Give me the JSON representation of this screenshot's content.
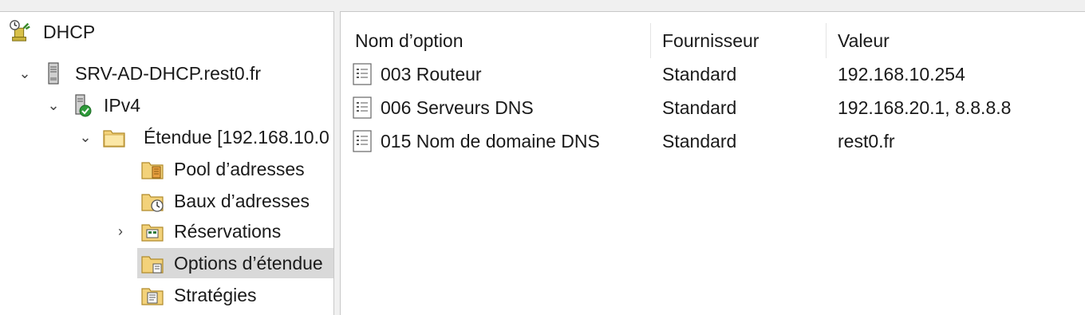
{
  "tree": {
    "root_label": "DHCP",
    "server_label": "SRV-AD-DHCP.rest0.fr",
    "ipv4_label": "IPv4",
    "scope_label": "Étendue [192.168.10.0",
    "pool_label": "Pool d’adresses",
    "leases_label": "Baux d’adresses",
    "reservations_label": "Réservations",
    "scope_options_label": "Options d’étendue",
    "policies_label": "Stratégies"
  },
  "list": {
    "columns": [
      "Nom d’option",
      "Fournisseur",
      "Valeur"
    ],
    "rows": [
      {
        "name": "003 Routeur",
        "vendor": "Standard",
        "value": "192.168.10.254"
      },
      {
        "name": "006 Serveurs DNS",
        "vendor": "Standard",
        "value": "192.168.20.1, 8.8.8.8"
      },
      {
        "name": "015 Nom de domaine DNS",
        "vendor": "Standard",
        "value": "rest0.fr"
      }
    ]
  },
  "icons": {
    "dhcp": "dhcp-root-icon",
    "server": "server-icon",
    "ipv4": "ipv4-icon",
    "folder": "folder-icon",
    "option": "option-document-icon"
  },
  "colors": {
    "selection": "#d9d9d9",
    "folder": "#f3d27a"
  }
}
